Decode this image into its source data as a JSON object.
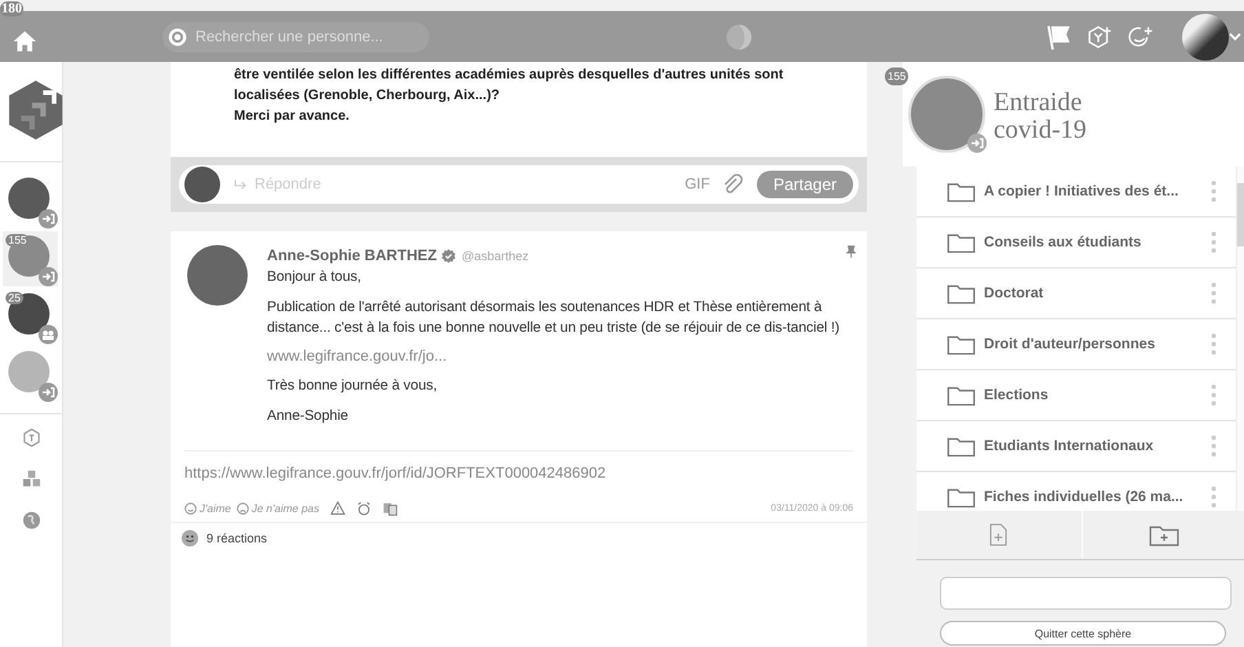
{
  "topbar": {
    "badge": "180",
    "search": {
      "placeholder": "Rechercher une personne..."
    }
  },
  "sidebar": {
    "spheres": [
      {
        "color": "#5a5a5a",
        "kind": "enter",
        "selected": false
      },
      {
        "color": "#8a8a8a",
        "badge": "155",
        "kind": "enter",
        "selected": true
      },
      {
        "color": "#4a4a4a",
        "badge": "25",
        "kind": "group",
        "selected": false
      },
      {
        "color": "#b5b5b5",
        "kind": "enter",
        "selected": false
      }
    ]
  },
  "previous_post": {
    "lines": [
      "être ventilée selon les différentes académies auprès desquelles d'autres unités sont localisées (Grenoble, Cherbourg, Aix...)?",
      "Merci par avance."
    ],
    "reply": {
      "placeholder": "Répondre",
      "gif": "GIF",
      "share": "Partager"
    }
  },
  "post": {
    "author": "Anne-Sophie BARTHEZ",
    "verified": true,
    "handle": "@asbarthez",
    "pinned": true,
    "paragraphs": [
      {
        "kind": "text",
        "text": "Bonjour à tous,"
      },
      {
        "kind": "text",
        "text": "Publication de l'arrêté autorisant désormais les soutenances HDR et Thèse entièrement à distance... c'est à la fois une bonne nouvelle et un peu triste (de se réjouir de ce dis-tanciel !)"
      },
      {
        "kind": "link",
        "text": "www.legifrance.gouv.fr/jo..."
      },
      {
        "kind": "text",
        "text": "Très bonne journée à vous,"
      },
      {
        "kind": "text",
        "text": "Anne-Sophie"
      }
    ],
    "url": "https://www.legifrance.gouv.fr/jorf/id/JORFTEXT000042486902",
    "actions": [
      {
        "kind": "like",
        "label": "J'aime"
      },
      {
        "kind": "dislike",
        "label": "Je n'aime pas"
      }
    ],
    "date": "03/11/2020 à 09:06",
    "reactions": "9 réactions"
  },
  "sphere": {
    "badge": "155",
    "title": "Entraide covid-19",
    "folders": [
      {
        "name": "A copier ! Initiatives des ét..."
      },
      {
        "name": "Conseils aux étudiants"
      },
      {
        "name": "Doctorat"
      },
      {
        "name": "Droit d'auteur/personnes"
      },
      {
        "name": "Elections"
      },
      {
        "name": "Etudiants Internationaux"
      },
      {
        "name": "Fiches individuelles (26 ma..."
      }
    ],
    "quit": "Quitter cette sphère"
  }
}
